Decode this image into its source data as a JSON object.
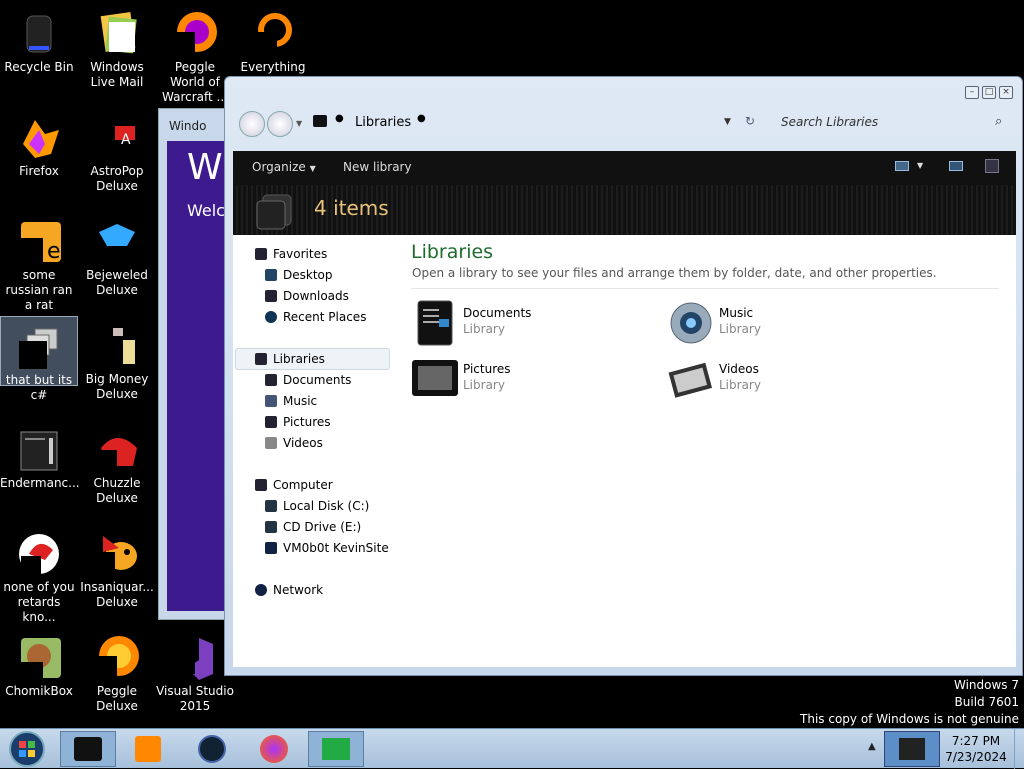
{
  "desktop": {
    "icons": [
      {
        "label": "Recycle Bin"
      },
      {
        "label": "Windows Live Mail"
      },
      {
        "label": "Peggle World of Warcraft ..."
      },
      {
        "label": "Everything"
      },
      {
        "label": "Firefox"
      },
      {
        "label": "AstroPop Deluxe"
      },
      {
        "label": "some russian ran a rat"
      },
      {
        "label": "Bejeweled Deluxe"
      },
      {
        "label": "that but its c#"
      },
      {
        "label": "Big Money Deluxe"
      },
      {
        "label": "Endermanc..."
      },
      {
        "label": "Chuzzle Deluxe"
      },
      {
        "label": "none of you retards kno..."
      },
      {
        "label": "Insaniquar... Deluxe"
      },
      {
        "label": "ChomikBox"
      },
      {
        "label": "Peggle Deluxe"
      },
      {
        "label": "Visual Studio 2015"
      }
    ],
    "watermark": {
      "line1": "Windows 7",
      "line2": "Build 7601",
      "line3": "This copy of Windows is not genuine"
    }
  },
  "back_window": {
    "title": "Windo",
    "heading": "Wi",
    "text": "Welco"
  },
  "explorer": {
    "address": "Libraries",
    "search_placeholder": "Search Libraries",
    "toolbar": {
      "organize": "Organize",
      "new_library": "New library"
    },
    "header_count": "4 items",
    "nav": {
      "favorites": "Favorites",
      "desktop": "Desktop",
      "downloads": "Downloads",
      "recent_places": "Recent Places",
      "libraries": "Libraries",
      "documents": "Documents",
      "music": "Music",
      "pictures": "Pictures",
      "videos": "Videos",
      "computer": "Computer",
      "local_disk": "Local Disk (C:)",
      "cd_drive": "CD Drive (E:)",
      "vm": "VM0b0t KevinSite",
      "network": "Network"
    },
    "main_title": "Libraries",
    "main_subtitle": "Open a library to see your files and arrange them by folder, date, and other properties.",
    "libraries": [
      {
        "name": "Documents",
        "type": "Library"
      },
      {
        "name": "Music",
        "type": "Library"
      },
      {
        "name": "Pictures",
        "type": "Library"
      },
      {
        "name": "Videos",
        "type": "Library"
      }
    ]
  },
  "taskbar": {
    "time": "7:27 PM",
    "date": "7/23/2024"
  }
}
